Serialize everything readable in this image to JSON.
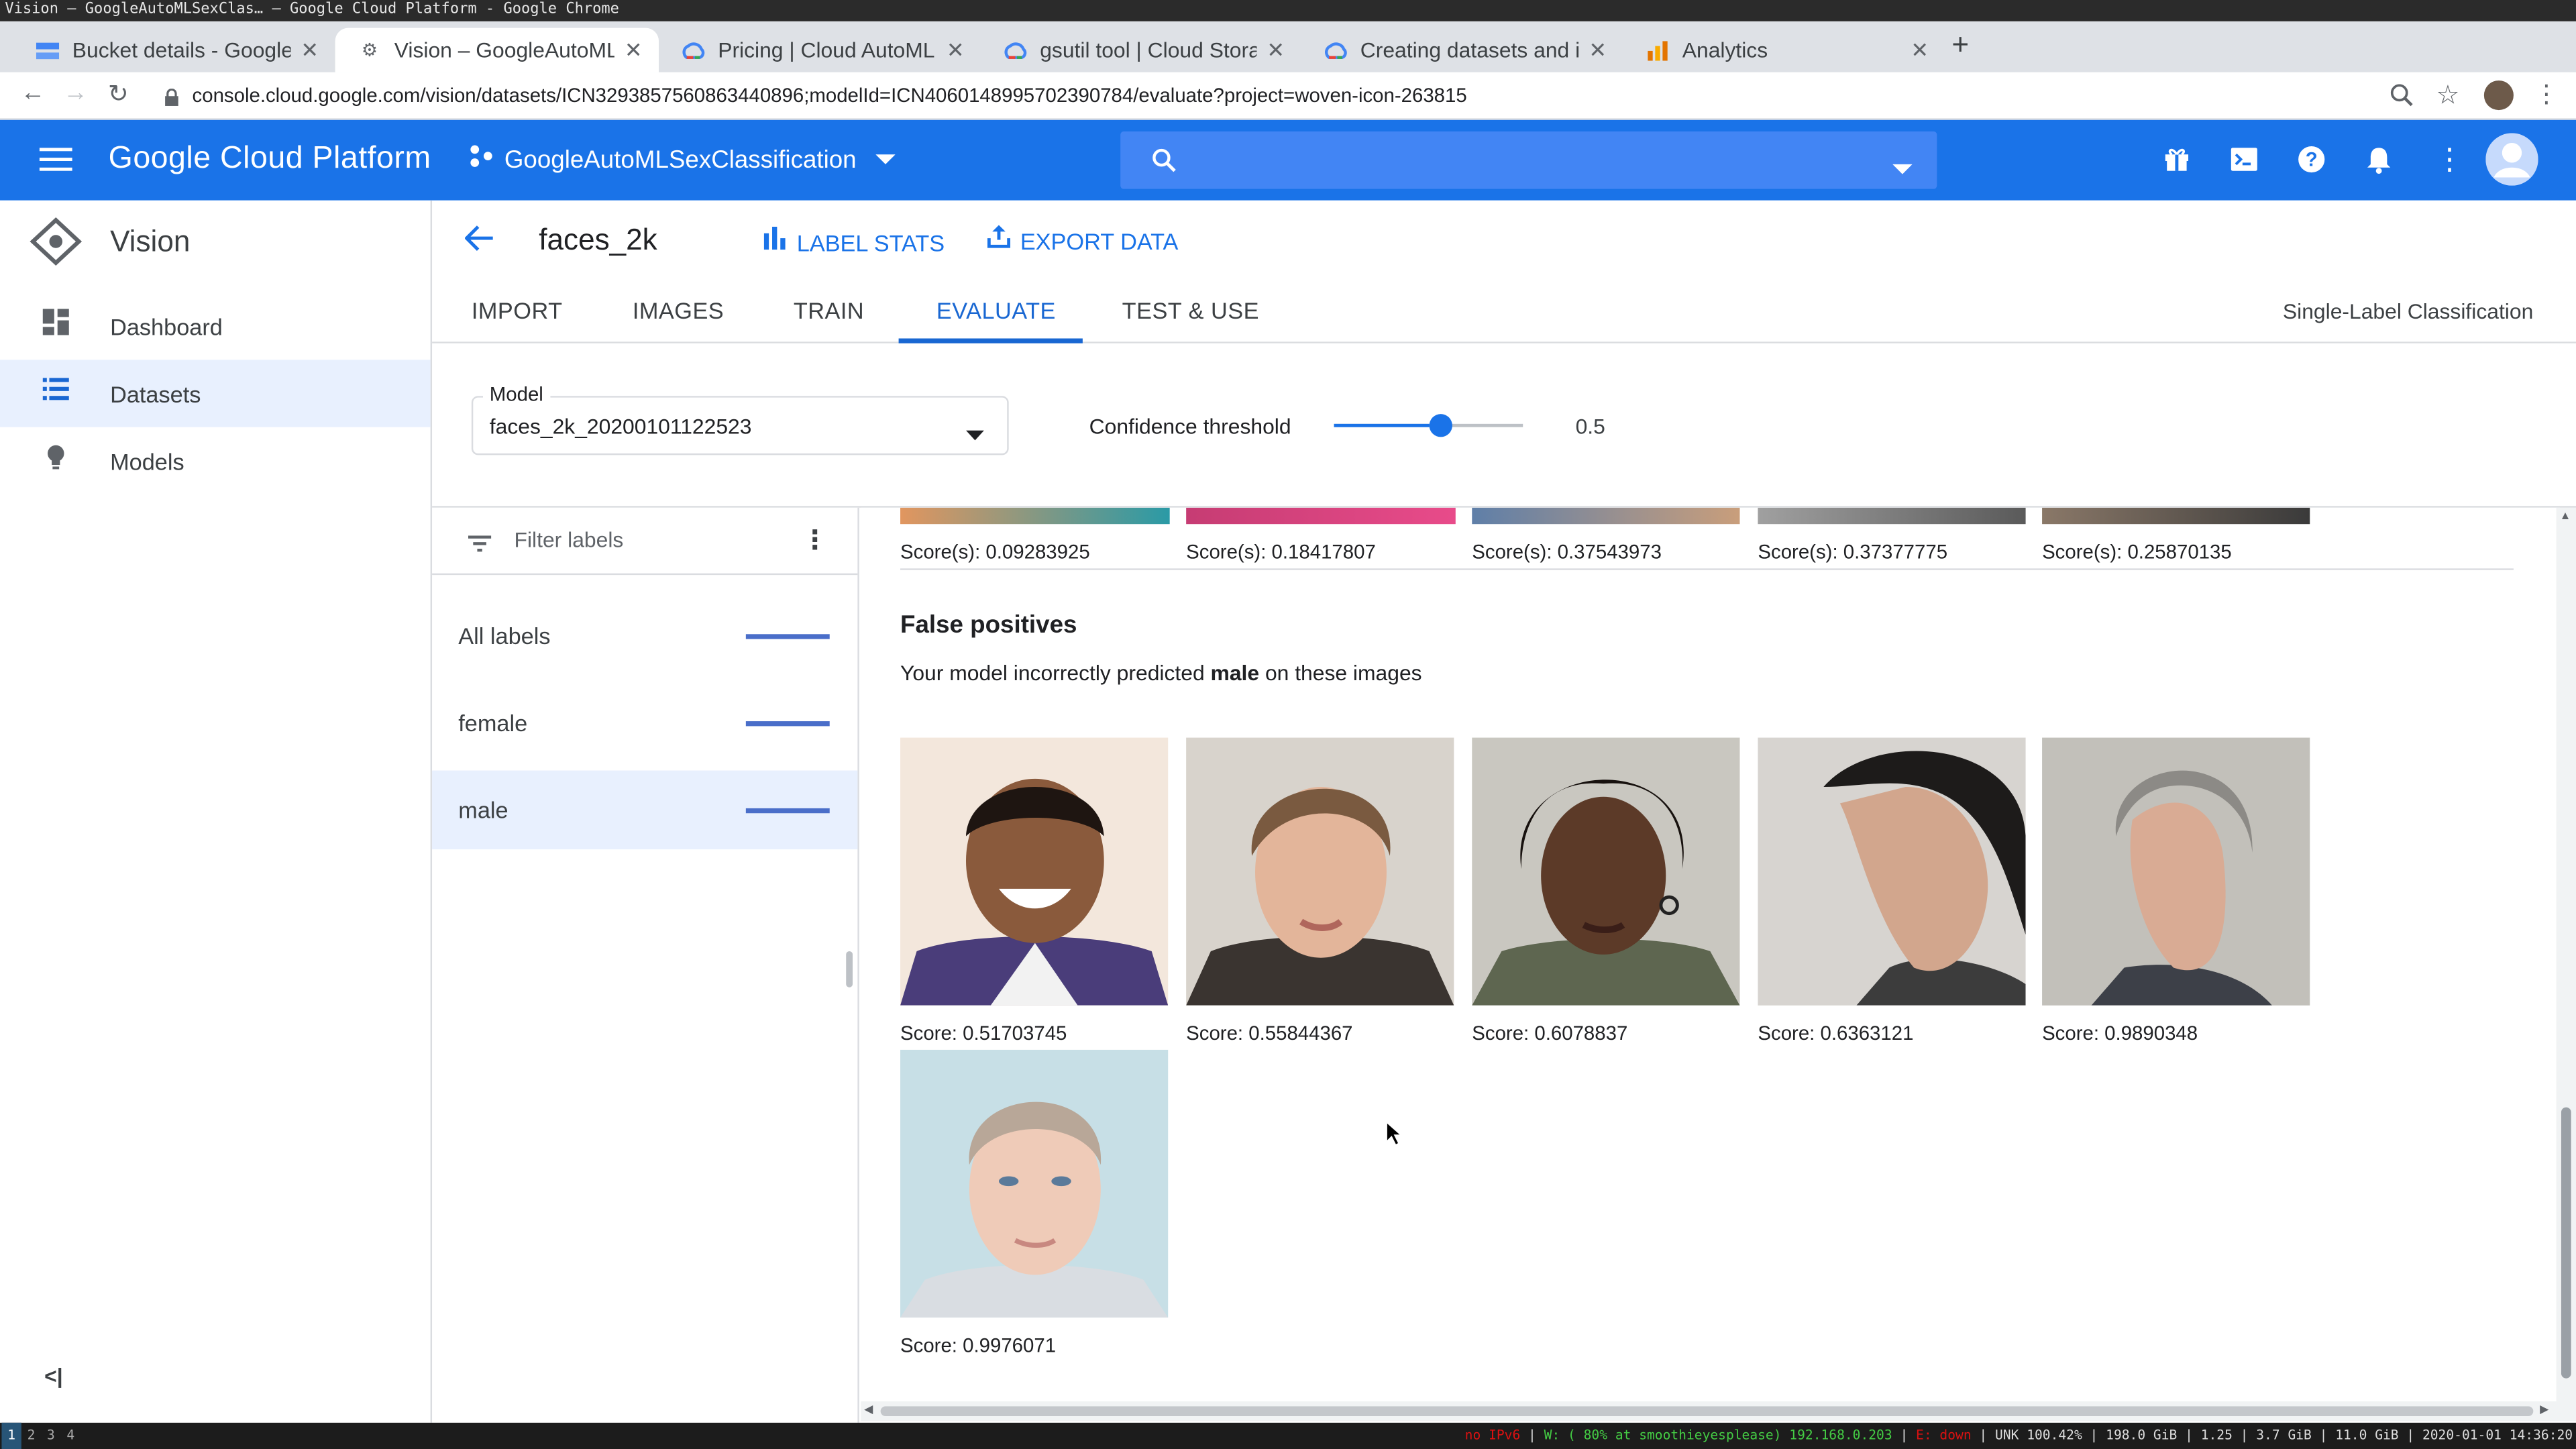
{
  "os": {
    "window_title": "Vision – GoogleAutoMLSexClas… – Google Cloud Platform - Google Chrome"
  },
  "browser": {
    "tabs": [
      {
        "label": "Bucket details - GoogleAu",
        "icon": "storage-icon"
      },
      {
        "label": "Vision – GoogleAutoMLSe",
        "icon": "gear-icon"
      },
      {
        "label": "Pricing | Cloud AutoML V",
        "icon": "gcloud-icon"
      },
      {
        "label": "gsutil tool | Cloud Storage",
        "icon": "gcloud-icon"
      },
      {
        "label": "Creating datasets and imp",
        "icon": "gcloud-icon"
      },
      {
        "label": "Analytics",
        "icon": "analytics-icon"
      }
    ],
    "new_tab": "+",
    "url": "console.cloud.google.com/vision/datasets/ICN3293857560863440896;modelId=ICN4060148995702390784/evaluate?project=woven-icon-263815"
  },
  "gcp": {
    "product": "Google Cloud Platform",
    "project": "GoogleAutoMLSexClassification"
  },
  "sidebar": {
    "title": "Vision",
    "items": [
      {
        "label": "Dashboard",
        "icon": "dashboard-icon"
      },
      {
        "label": "Datasets",
        "icon": "list-icon"
      },
      {
        "label": "Models",
        "icon": "lightbulb-icon"
      }
    ]
  },
  "toolbar": {
    "dataset_name": "faces_2k",
    "label_stats": "LABEL STATS",
    "export_data": "EXPORT DATA"
  },
  "tabs": [
    "IMPORT",
    "IMAGES",
    "TRAIN",
    "EVALUATE",
    "TEST & USE"
  ],
  "active_tab": "EVALUATE",
  "classification_type": "Single-Label Classification",
  "model_select": {
    "label": "Model",
    "value": "faces_2k_20200101122523"
  },
  "confidence": {
    "label": "Confidence threshold",
    "value": "0.5",
    "fraction": 0.5
  },
  "filter": {
    "placeholder": "Filter labels",
    "labels": [
      "All labels",
      "female",
      "male"
    ],
    "selected": "male"
  },
  "prev_row_scores": [
    "Score(s): 0.09283925",
    "Score(s): 0.18417807",
    "Score(s): 0.37543973",
    "Score(s): 0.37377775",
    "Score(s): 0.25870135"
  ],
  "false_positives": {
    "heading": "False positives",
    "desc_prefix": "Your model incorrectly predicted ",
    "desc_label": "male",
    "desc_suffix": " on these images",
    "scores": [
      "Score: 0.51703745",
      "Score: 0.55844367",
      "Score: 0.6078837",
      "Score: 0.6363121",
      "Score: 0.9890348",
      "Score: 0.9976071"
    ]
  },
  "status": {
    "workspaces": [
      "1",
      "2",
      "3",
      "4"
    ],
    "text_left": "no IPv6",
    "text_mid": "W: ( 80% at smoothieyesplease) 192.168.0.203",
    "text_eth": "E: down",
    "text_right": "UNK 100.42% | 198.0 GiB | 1.25 | 3.7 GiB | 11.0 GiB | 2020-01-01 14:36:20"
  },
  "colors": {
    "brand_blue": "#1a73e8",
    "selected_bg": "#e8f0fe",
    "accent_text": "#1967d2"
  }
}
